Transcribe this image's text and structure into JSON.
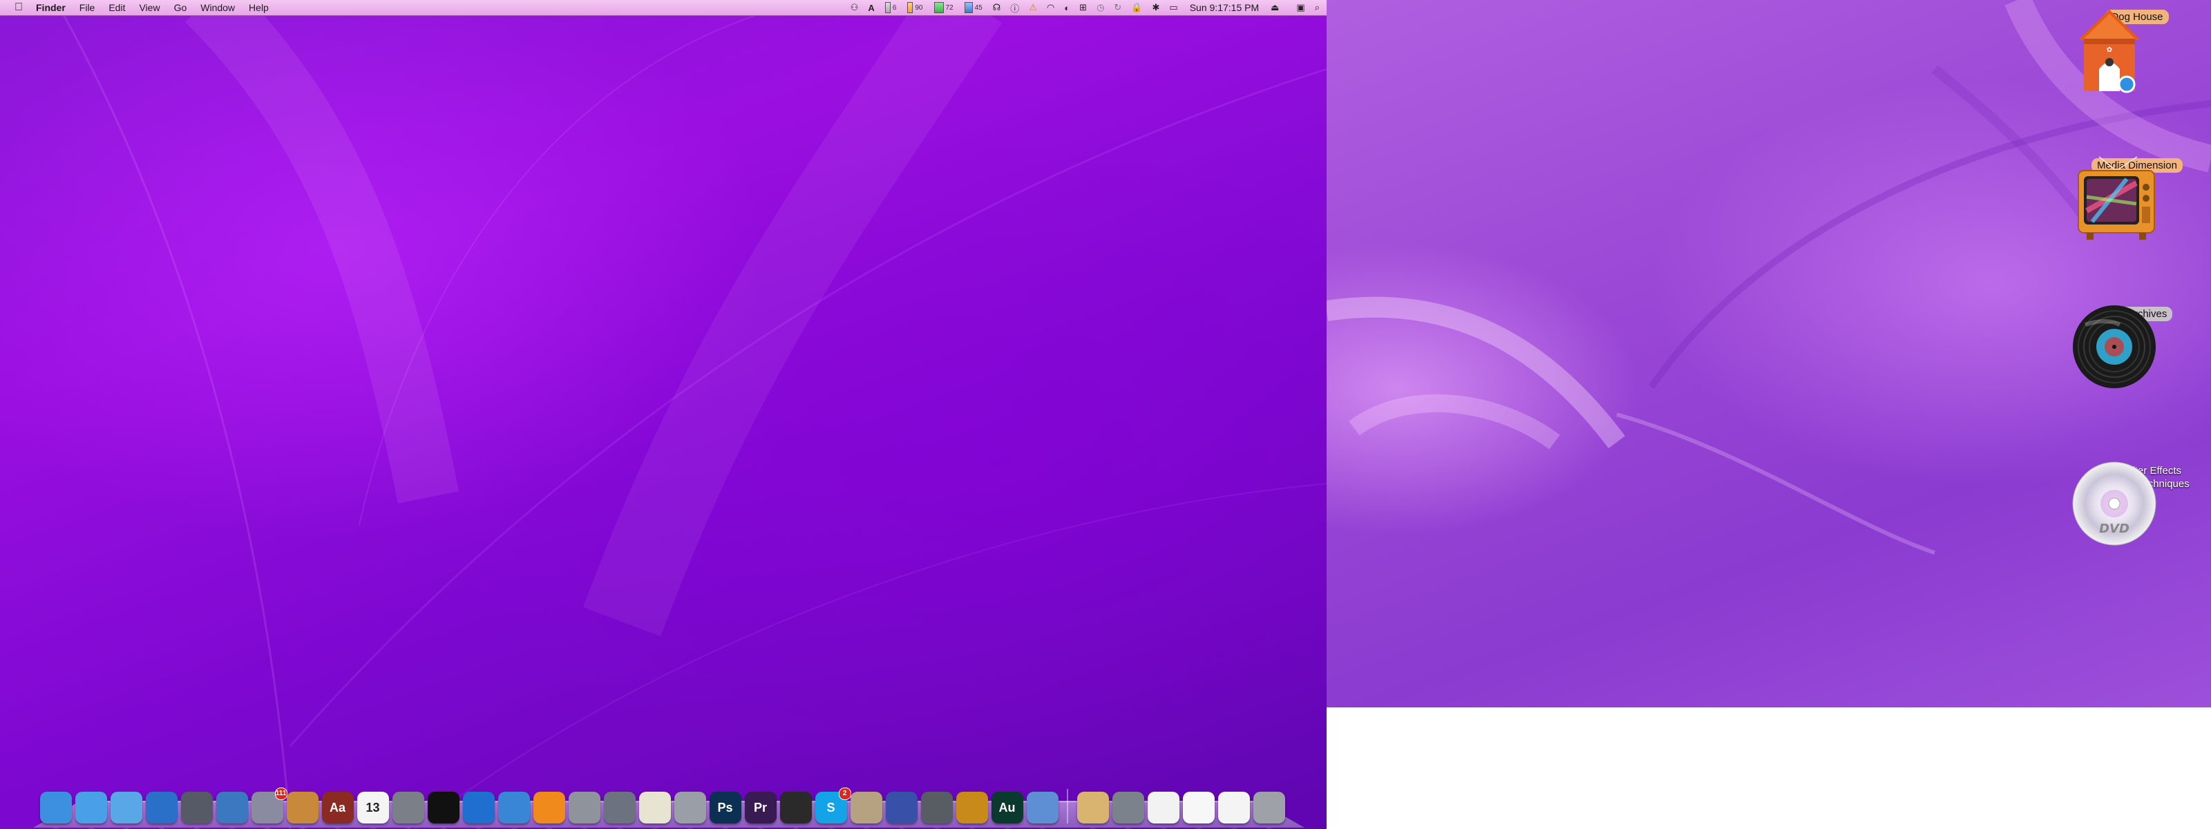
{
  "menubar": {
    "apple_glyph": "",
    "app_name": "Finder",
    "menus": [
      "File",
      "Edit",
      "View",
      "Go",
      "Window",
      "Help"
    ],
    "meters": [
      {
        "value": "6",
        "color": "#9aa0a6"
      },
      {
        "value": "90",
        "color": "#f0a030"
      },
      {
        "value": "72",
        "color": "#39b54a"
      },
      {
        "value": "45",
        "color": "#3a7bd5"
      }
    ],
    "clock": "Sun 9:17:15 PM",
    "status_icons": [
      "headphones-icon",
      "info-icon",
      "warning-icon",
      "wifi-icon",
      "bluetooth-icon",
      "eject-icon",
      "spotlight-icon"
    ]
  },
  "dock": {
    "apps": [
      {
        "name": "finder-icon",
        "color": "#3d8fe0"
      },
      {
        "name": "safari-icon",
        "color": "#4aa0e8"
      },
      {
        "name": "ichat-icon",
        "color": "#5aa7e8"
      },
      {
        "name": "itunes-icon",
        "color": "#2a70c8"
      },
      {
        "name": "launchpad-icon",
        "color": "#555a66"
      },
      {
        "name": "mail-icon",
        "color": "#3b78c0"
      },
      {
        "name": "textedit-icon",
        "color": "#8a8aa0",
        "badge": "111"
      },
      {
        "name": "iphoto-icon",
        "color": "#c9893a"
      },
      {
        "name": "dictionary-icon",
        "text": "Aa",
        "color": "#8b2a22"
      },
      {
        "name": "calendar-icon",
        "text": "13",
        "color": "#f4f4f4"
      },
      {
        "name": "script-editor-icon",
        "color": "#7a7f88"
      },
      {
        "name": "terminal-icon",
        "color": "#111111"
      },
      {
        "name": "quicktime-icon",
        "color": "#1f6fd0"
      },
      {
        "name": "preview-icon",
        "color": "#3a86d6"
      },
      {
        "name": "vlc-icon",
        "color": "#f08a1c"
      },
      {
        "name": "system-preferences-icon",
        "color": "#8f949c"
      },
      {
        "name": "image-capture-icon",
        "color": "#6c7280"
      },
      {
        "name": "notes-icon",
        "color": "#e8e4d2"
      },
      {
        "name": "utilities-icon",
        "color": "#9a9ea6"
      },
      {
        "name": "photoshop-icon",
        "text": "Ps",
        "color": "#0c2f54"
      },
      {
        "name": "premiere-icon",
        "text": "Pr",
        "color": "#3a1a52"
      },
      {
        "name": "final-cut-icon",
        "color": "#2a2a2a"
      },
      {
        "name": "skype-icon",
        "text": "S",
        "color": "#13a3e8",
        "badge": "2"
      },
      {
        "name": "coffee-icon",
        "color": "#b6a180"
      },
      {
        "name": "network-icon",
        "color": "#3850a8"
      },
      {
        "name": "hard-drive-icon",
        "color": "#585c63"
      },
      {
        "name": "compass-icon",
        "color": "#c88b1a"
      },
      {
        "name": "audition-icon",
        "text": "Au",
        "color": "#0a3a2e"
      },
      {
        "name": "installer-icon",
        "color": "#5e8ed4"
      }
    ],
    "docs": [
      {
        "name": "zip-archive-icon",
        "color": "#d8b470"
      },
      {
        "name": "settings-stack-icon",
        "color": "#7c828c"
      },
      {
        "name": "document-stack-icon",
        "color": "#f2f2f2"
      },
      {
        "name": "document-stack-2-icon",
        "color": "#f7f7f7"
      },
      {
        "name": "document-stack-3-icon",
        "color": "#f4f4f4"
      },
      {
        "name": "trash-icon",
        "color": "#9ea2a8"
      }
    ]
  },
  "desktop": {
    "icons": [
      {
        "label": "Dog House",
        "style": "sel-orange"
      },
      {
        "label": "Media Dimension",
        "style": "sel-orange"
      },
      {
        "label": "The Archives",
        "style": "sel-gray"
      },
      {
        "label": "Adobe After Effects CS6 Visua...echniques",
        "style": "plain",
        "line1": "Adobe After Effects",
        "line2": "CS6 Visua...echniques",
        "disc_text": "DVD"
      }
    ]
  }
}
